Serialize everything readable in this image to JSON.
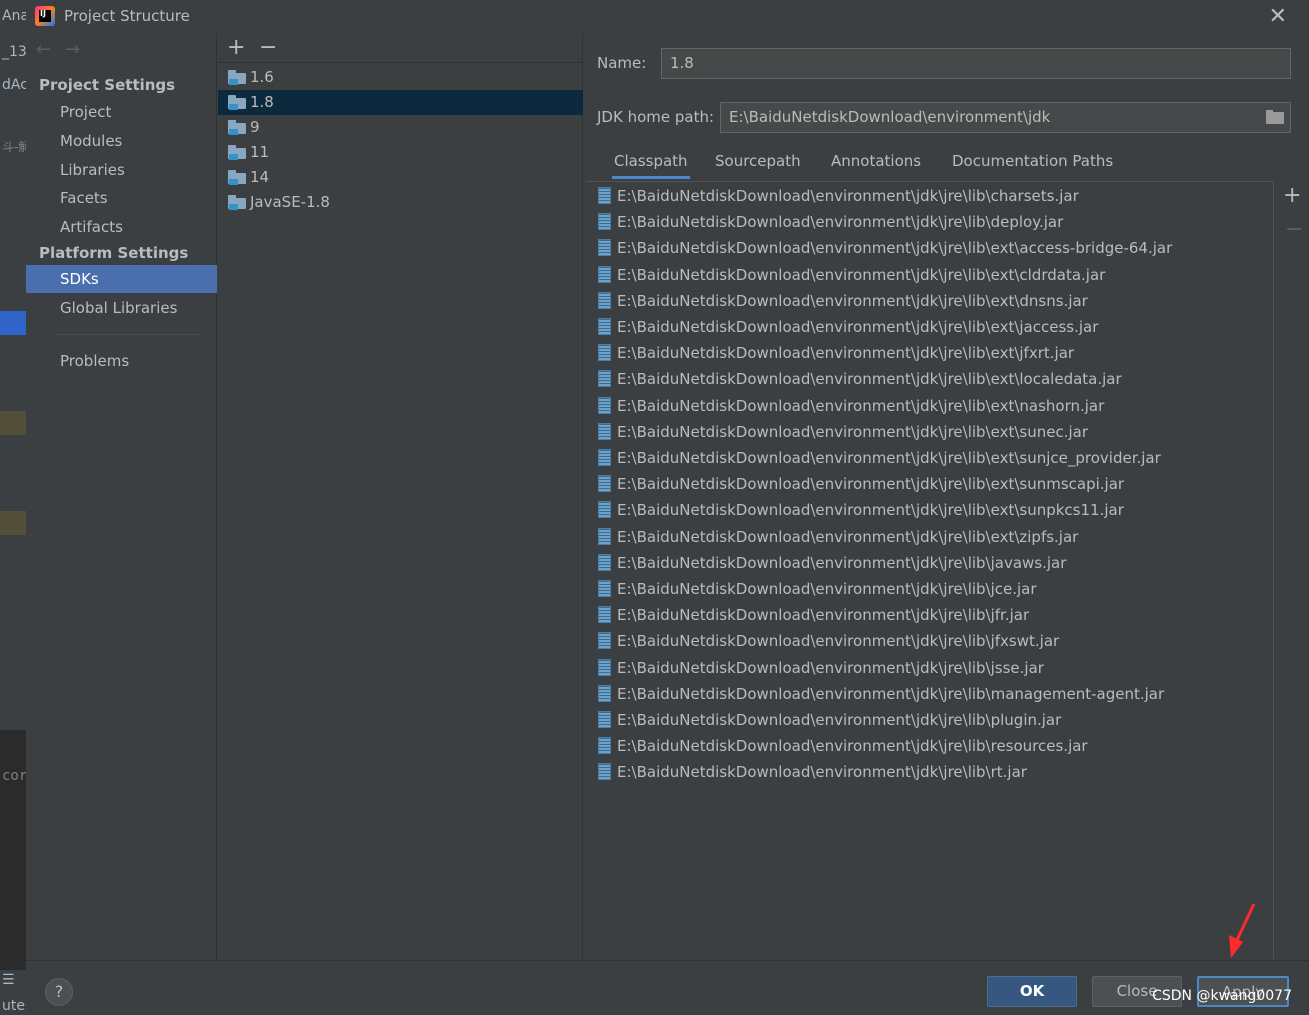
{
  "background_ide": {
    "fragments": [
      "Ana",
      "_13",
      "dAc",
      "斗-解",
      "cor",
      "☰",
      "utes"
    ]
  },
  "dialog": {
    "title": "Project Structure",
    "close_icon": "close-icon"
  },
  "nav": {
    "back_icon": "arrow-left-icon",
    "forward_icon": "arrow-right-icon",
    "project_settings_header": "Project Settings",
    "project_settings_items": [
      "Project",
      "Modules",
      "Libraries",
      "Facets",
      "Artifacts"
    ],
    "platform_settings_header": "Platform Settings",
    "platform_settings_items": [
      "SDKs",
      "Global Libraries"
    ],
    "problems": "Problems",
    "selected": "SDKs"
  },
  "sdk_list": {
    "add_label": "+",
    "remove_label": "−",
    "items": [
      "1.6",
      "1.8",
      "9",
      "11",
      "14",
      "JavaSE-1.8"
    ],
    "selected": "1.8"
  },
  "detail": {
    "name_label": "Name:",
    "name_value": "1.8",
    "jdk_home_label": "JDK home path:",
    "jdk_home_value": "E:\\BaiduNetdiskDownload\\environment\\jdk",
    "tabs": [
      "Classpath",
      "Sourcepath",
      "Annotations",
      "Documentation Paths"
    ],
    "active_tab": "Classpath",
    "side_add": "+",
    "side_remove": "−",
    "classpath": [
      "E:\\BaiduNetdiskDownload\\environment\\jdk\\jre\\lib\\charsets.jar",
      "E:\\BaiduNetdiskDownload\\environment\\jdk\\jre\\lib\\deploy.jar",
      "E:\\BaiduNetdiskDownload\\environment\\jdk\\jre\\lib\\ext\\access-bridge-64.jar",
      "E:\\BaiduNetdiskDownload\\environment\\jdk\\jre\\lib\\ext\\cldrdata.jar",
      "E:\\BaiduNetdiskDownload\\environment\\jdk\\jre\\lib\\ext\\dnsns.jar",
      "E:\\BaiduNetdiskDownload\\environment\\jdk\\jre\\lib\\ext\\jaccess.jar",
      "E:\\BaiduNetdiskDownload\\environment\\jdk\\jre\\lib\\ext\\jfxrt.jar",
      "E:\\BaiduNetdiskDownload\\environment\\jdk\\jre\\lib\\ext\\localedata.jar",
      "E:\\BaiduNetdiskDownload\\environment\\jdk\\jre\\lib\\ext\\nashorn.jar",
      "E:\\BaiduNetdiskDownload\\environment\\jdk\\jre\\lib\\ext\\sunec.jar",
      "E:\\BaiduNetdiskDownload\\environment\\jdk\\jre\\lib\\ext\\sunjce_provider.jar",
      "E:\\BaiduNetdiskDownload\\environment\\jdk\\jre\\lib\\ext\\sunmscapi.jar",
      "E:\\BaiduNetdiskDownload\\environment\\jdk\\jre\\lib\\ext\\sunpkcs11.jar",
      "E:\\BaiduNetdiskDownload\\environment\\jdk\\jre\\lib\\ext\\zipfs.jar",
      "E:\\BaiduNetdiskDownload\\environment\\jdk\\jre\\lib\\javaws.jar",
      "E:\\BaiduNetdiskDownload\\environment\\jdk\\jre\\lib\\jce.jar",
      "E:\\BaiduNetdiskDownload\\environment\\jdk\\jre\\lib\\jfr.jar",
      "E:\\BaiduNetdiskDownload\\environment\\jdk\\jre\\lib\\jfxswt.jar",
      "E:\\BaiduNetdiskDownload\\environment\\jdk\\jre\\lib\\jsse.jar",
      "E:\\BaiduNetdiskDownload\\environment\\jdk\\jre\\lib\\management-agent.jar",
      "E:\\BaiduNetdiskDownload\\environment\\jdk\\jre\\lib\\plugin.jar",
      "E:\\BaiduNetdiskDownload\\environment\\jdk\\jre\\lib\\resources.jar",
      "E:\\BaiduNetdiskDownload\\environment\\jdk\\jre\\lib\\rt.jar"
    ]
  },
  "footer": {
    "help_label": "?",
    "ok_label": "OK",
    "close_label": "Close",
    "apply_label": "Apply",
    "watermark": "CSDN @kwang0077"
  },
  "colors": {
    "selection": "#4b6eaf",
    "sdk_selection": "#0d293e",
    "primary_button": "#365880",
    "annotation_arrow": "#ff2a2a"
  }
}
